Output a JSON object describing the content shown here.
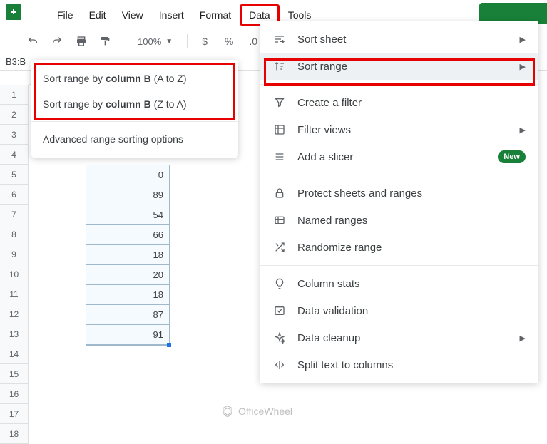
{
  "menubar": [
    "File",
    "Edit",
    "View",
    "Insert",
    "Format",
    "Data",
    "Tools"
  ],
  "toolbar": {
    "zoom": "100%",
    "currency": "$",
    "percent": "%",
    "decimal": ".0"
  },
  "namebox": "B3:B",
  "rows": [
    1,
    2,
    3,
    4,
    5,
    6,
    7,
    8,
    9,
    10,
    11,
    12,
    13,
    14,
    15,
    16,
    17,
    18
  ],
  "cells": [
    "0",
    "89",
    "54",
    "66",
    "18",
    "20",
    "18",
    "87",
    "91"
  ],
  "submenu": {
    "atoz_pre": "Sort range by ",
    "atoz_bold": "column B",
    "atoz_post": " (A to Z)",
    "ztoa_pre": "Sort range by ",
    "ztoa_bold": "column B",
    "ztoa_post": " (Z to A)",
    "advanced": "Advanced range sorting options"
  },
  "mainmenu": {
    "sort_sheet": "Sort sheet",
    "sort_range": "Sort range",
    "create_filter": "Create a filter",
    "filter_views": "Filter views",
    "add_slicer": "Add a slicer",
    "new": "New",
    "protect": "Protect sheets and ranges",
    "named": "Named ranges",
    "randomize": "Randomize range",
    "column_stats": "Column stats",
    "validation": "Data validation",
    "cleanup": "Data cleanup",
    "split": "Split text to columns"
  },
  "watermark": "OfficeWheel"
}
